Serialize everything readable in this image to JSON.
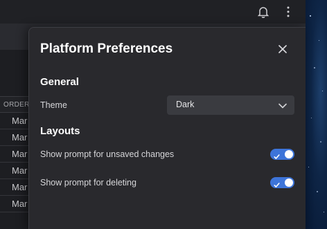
{
  "dialog": {
    "title": "Platform Preferences",
    "close_icon": "close-icon",
    "general": {
      "heading": "General",
      "theme_label": "Theme",
      "theme_value": "Dark"
    },
    "layouts": {
      "heading": "Layouts",
      "toggles": [
        {
          "label": "Show prompt for unsaved changes",
          "on": true
        },
        {
          "label": "Show prompt for deleting",
          "on": true
        }
      ]
    }
  },
  "topbar": {
    "icons": [
      "bell-icon",
      "more-vertical-icon"
    ]
  },
  "background_table": {
    "header": "ORDER",
    "rows": [
      "Mar",
      "Mar",
      "Mar",
      "Mar",
      "Mar",
      "Mar"
    ]
  },
  "colors": {
    "accent": "#3d74d9",
    "dialog_bg": "#29292d",
    "select_bg": "#3a3b40"
  }
}
